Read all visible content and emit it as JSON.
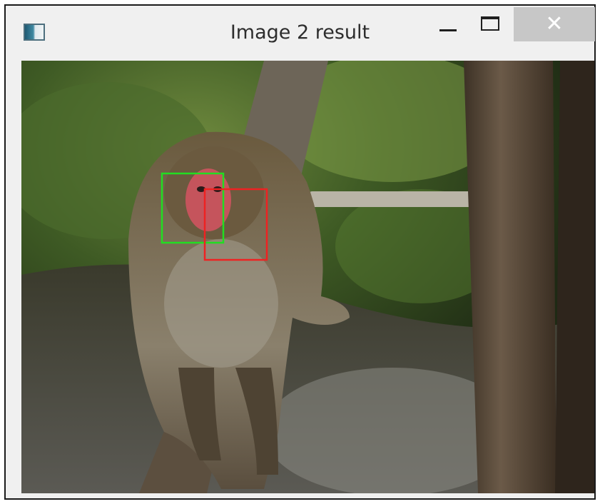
{
  "window": {
    "title": "Image 2 result",
    "icon": "app-icon",
    "controls": {
      "minimize_icon": "minimize-icon",
      "maximize_icon": "maximize-icon",
      "close_glyph": "✕",
      "close_hover_color": "#c7c7c7"
    }
  },
  "image": {
    "description_icon": "photo",
    "detections": [
      {
        "name": "face-detection-box-green",
        "color": "#22dd22"
      },
      {
        "name": "face-detection-box-red",
        "color": "#ee2222"
      }
    ]
  }
}
